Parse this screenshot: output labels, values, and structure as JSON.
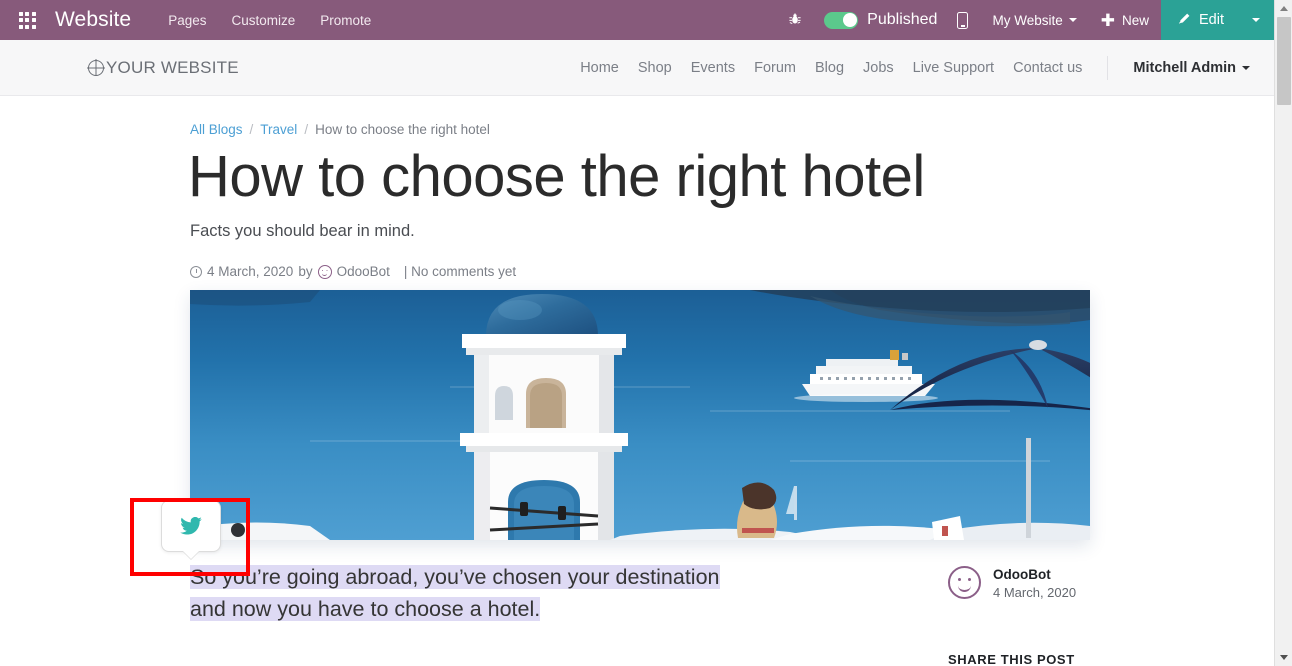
{
  "systray": {
    "apps_icon": "apps-grid-icon",
    "brand": "Website",
    "menu": [
      {
        "label": "Pages"
      },
      {
        "label": "Customize"
      },
      {
        "label": "Promote"
      }
    ],
    "bug_icon": "bug-icon",
    "publish_label": "Published",
    "publish_state": "on",
    "mobile_icon": "mobile-preview-icon",
    "website_selector": "My Website",
    "new_label": "New",
    "new_icon": "plus-icon",
    "edit_label": "Edit",
    "edit_icon": "pencil-icon",
    "colors": {
      "bar": "#875A7B",
      "edit": "#2BA296",
      "toggle_on": "#5BC98C"
    }
  },
  "site_header": {
    "logo_text": "YOUR WEBSITE",
    "logo_icon": "globe-icon",
    "nav": [
      {
        "label": "Home"
      },
      {
        "label": "Shop"
      },
      {
        "label": "Events"
      },
      {
        "label": "Forum"
      },
      {
        "label": "Blog"
      },
      {
        "label": "Jobs"
      },
      {
        "label": "Live Support"
      },
      {
        "label": "Contact us"
      }
    ],
    "user": "Mitchell Admin"
  },
  "breadcrumb": {
    "items": [
      {
        "label": "All Blogs",
        "link": true
      },
      {
        "label": "Travel",
        "link": true
      },
      {
        "label": "How to choose the right hotel",
        "link": false
      }
    ],
    "separator": "/"
  },
  "post": {
    "title": "How to choose the right hotel",
    "subtitle": "Facts you should bear in mind.",
    "meta": {
      "clock_icon": "clock-icon",
      "date": "4 March, 2020",
      "by": "by",
      "author_icon": "smiley-avatar-icon",
      "author": "OdooBot",
      "comments": "| No comments yet"
    },
    "hero_alt": "Santorini white bell tower with blue dome overlooking the sea, cruise ship and beach umbrella",
    "body_highlighted": "So you’re going abroad, you’ve chosen your destination and now you have to choose a hotel.",
    "selection_color": "#DEDAF4"
  },
  "share_tooltip": {
    "icon": "twitter-bird-icon",
    "color": "#1DA1A3"
  },
  "highlight_box": {
    "color": "#FF0000"
  },
  "sidebar": {
    "author_icon": "smiley-avatar-icon",
    "author_name": "OdooBot",
    "author_date": "4 March, 2020",
    "share_heading": "SHARE THIS POST"
  },
  "scrollbar": {
    "up_icon": "scroll-up-arrow-icon",
    "down_icon": "scroll-down-arrow-icon"
  }
}
